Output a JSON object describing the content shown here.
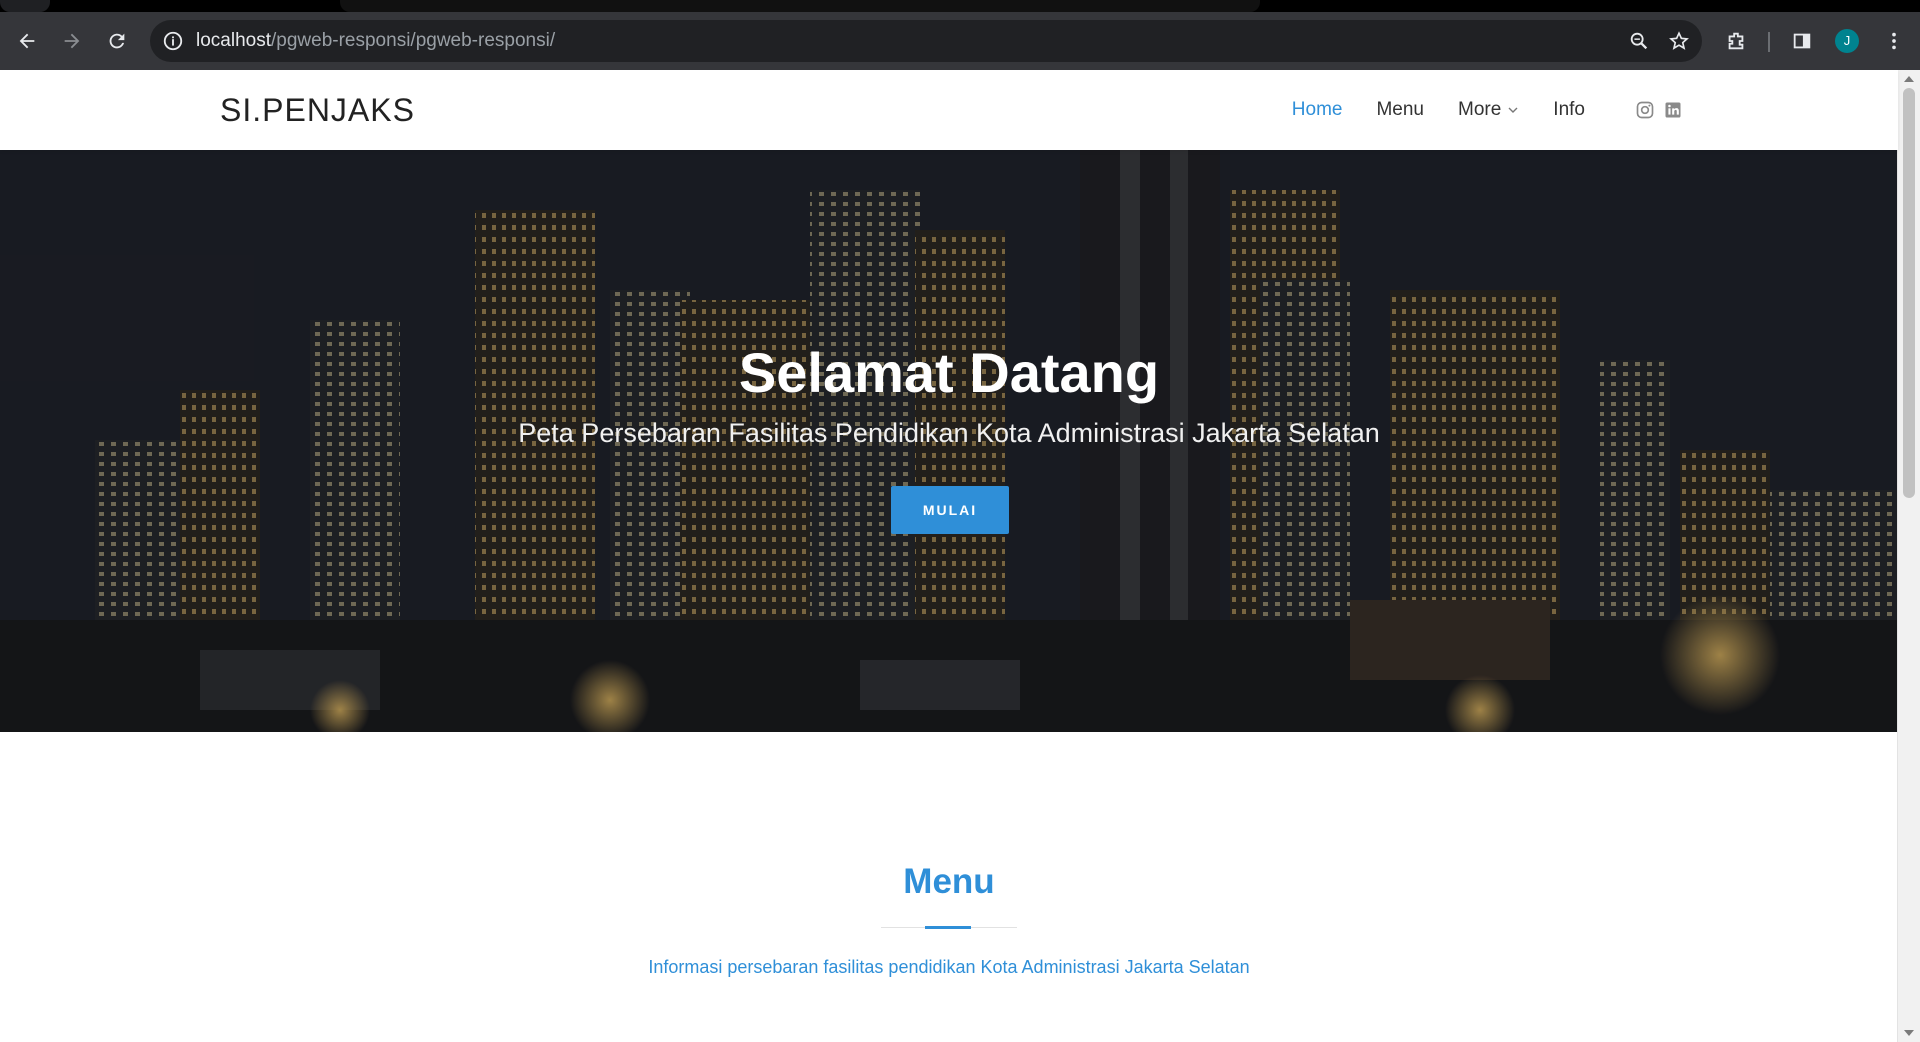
{
  "browser": {
    "url_host": "localhost",
    "url_path": "/pgweb-responsi/pgweb-responsi/",
    "profile_initial": "J",
    "icons": [
      "back-icon",
      "forward-icon",
      "reload-icon",
      "info-icon",
      "zoom-icon",
      "star-icon",
      "extensions-icon",
      "side-panel-icon",
      "menu-icon"
    ]
  },
  "navbar": {
    "logo": "SI.PENJAKS",
    "items": [
      {
        "label": "Home",
        "active": true
      },
      {
        "label": "Menu",
        "active": false
      },
      {
        "label": "More",
        "active": false,
        "dropdown": true
      },
      {
        "label": "Info",
        "active": false
      }
    ],
    "social": [
      "instagram-icon",
      "linkedin-icon"
    ]
  },
  "hero": {
    "title": "Selamat Datang",
    "subtitle": "Peta Persebaran Fasilitas Pendidikan Kota Administrasi Jakarta Selatan",
    "button_label": "MULAI"
  },
  "menu_section": {
    "title": "Menu",
    "description": "Informasi persebaran fasilitas pendidikan Kota Administrasi Jakarta Selatan"
  },
  "colors": {
    "accent": "#2f8fd8",
    "chrome_bg": "#35363a",
    "omnibox_bg": "#202124"
  }
}
